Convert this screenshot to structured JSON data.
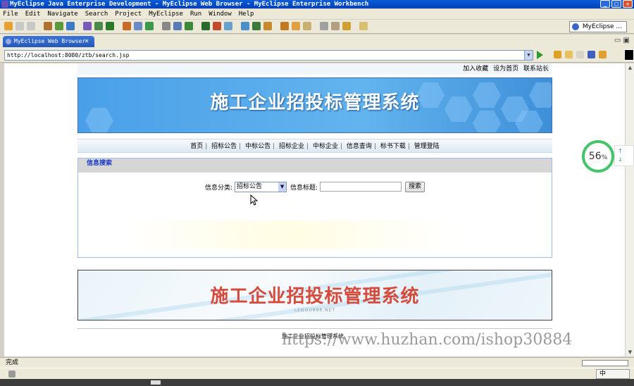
{
  "window": {
    "title": "MyEclipse Java Enterprise Development - MyEclipse Web Browser - MyEclipse Enterprise Workbench"
  },
  "menu": [
    "File",
    "Edit",
    "Navigate",
    "Search",
    "Project",
    "MyEclipse",
    "Run",
    "Window",
    "Help"
  ],
  "perspective": {
    "label": "MyEclipse ..."
  },
  "editor_tab": {
    "label": "MyEclipse Web Browser",
    "close": "✕"
  },
  "url": {
    "value": "http://localhost:8080/ztb/search.jsp"
  },
  "page": {
    "top_links": [
      "加入收藏",
      "设为首页",
      "联系站长"
    ],
    "banner_title": "施工企业招投标管理系统",
    "nav": [
      "首页",
      "招标公告",
      "中标公告",
      "招标企业",
      "中标企业",
      "信息查询",
      "标书下载",
      "管理登陆"
    ],
    "panel_title": "信息搜索",
    "form": {
      "category_label": "信息分类:",
      "category_value": "招标公告",
      "title_label": "信息标题:",
      "title_value": "",
      "search_button": "搜索"
    },
    "banner2_title": "施工企业招投标管理系统",
    "banner2_subtitle": "LEGOU888.NET",
    "footer": "施工企业招投标管理系统"
  },
  "watermark": "https://www.huzhan.com/ishop30884",
  "zoom": {
    "value": "56",
    "unit": "%"
  },
  "status": {
    "text": "完成"
  },
  "ime": {
    "label": "中"
  }
}
